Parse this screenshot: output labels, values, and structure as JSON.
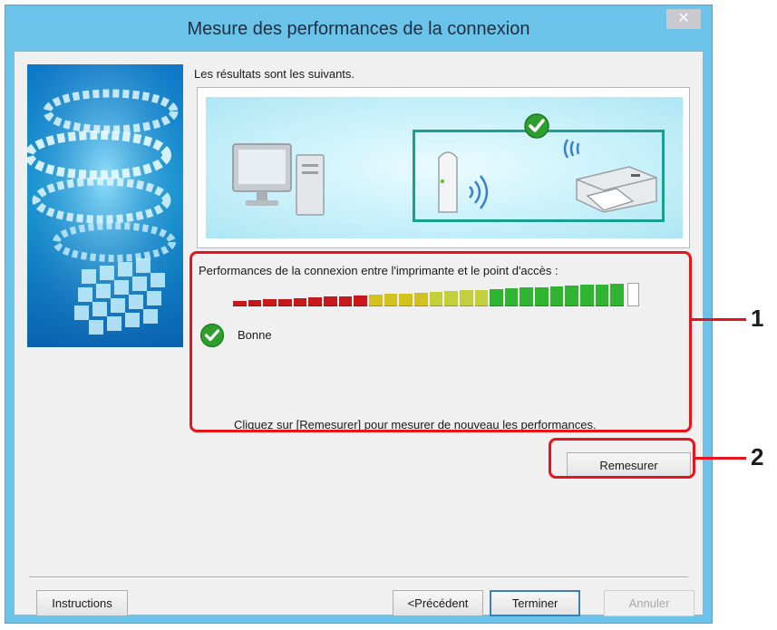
{
  "window": {
    "title": "Mesure des performances de la connexion",
    "close_glyph": "✕"
  },
  "content": {
    "heading": "Les résultats sont les suivants.",
    "perf_label": "Performances de la connexion entre l'imprimante et le point d'accès :",
    "meter": {
      "filled_segments": 26,
      "total_segments": 27
    },
    "status_text": "Bonne",
    "hint": "Cliquez sur [Remesurer] pour mesurer de nouveau les performances."
  },
  "buttons": {
    "remeasure": "Remesurer",
    "instructions": "Instructions",
    "previous": "<Précédent",
    "finish": "Terminer",
    "cancel": "Annuler"
  },
  "callouts": {
    "one": "1",
    "two": "2"
  },
  "icons": {
    "close": "close-icon",
    "computer": "computer-icon",
    "access_point": "access-point-icon",
    "printer": "printer-icon",
    "wifi": "wifi-signal-icon",
    "status": "checkmark-icon"
  },
  "colors": {
    "title_bar": "#6cc3ea",
    "good": "#2e9e2e",
    "callout": "#e8141c",
    "connection_box": "#1a9e8f"
  }
}
